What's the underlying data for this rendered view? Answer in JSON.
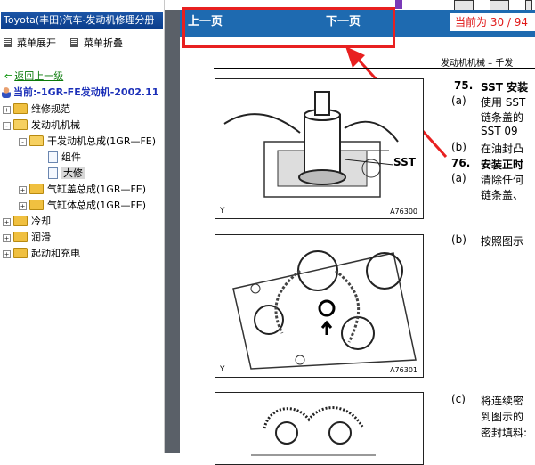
{
  "left_pane": {
    "title": "Toyota(丰田)汽车-发动机修理分册",
    "expand_label": "菜单展开",
    "collapse_label": "菜单折叠",
    "back_label": "返回上一级",
    "current_label": "当前:-1GR-FE发动机-2002.11",
    "tree": [
      {
        "label": "维修规范",
        "expander": "+",
        "type": "folder"
      },
      {
        "label": "发动机机械",
        "expander": "-",
        "type": "folder"
      },
      {
        "label": "干发动机总成(1GR—FE)",
        "expander": "-",
        "type": "folder"
      },
      {
        "label": "组件",
        "expander": "",
        "type": "doc"
      },
      {
        "label": "大修",
        "expander": "",
        "type": "doc",
        "selected": true
      },
      {
        "label": "气缸盖总成(1GR—FE)",
        "expander": "+",
        "type": "folder"
      },
      {
        "label": "气缸体总成(1GR—FE)",
        "expander": "+",
        "type": "folder"
      },
      {
        "label": "冷却",
        "expander": "+",
        "type": "folder"
      },
      {
        "label": "润滑",
        "expander": "+",
        "type": "folder"
      },
      {
        "label": "起动和充电",
        "expander": "+",
        "type": "folder"
      }
    ]
  },
  "toolbar": {
    "prev_label": "上一页",
    "next_label": "下一页",
    "page_indicator": "当前为 30 / 94"
  },
  "document": {
    "section_header": "发动机机械 – 千发",
    "figures": [
      {
        "code": "A76300",
        "corner": "Y",
        "callout": "SST"
      },
      {
        "code": "A76301",
        "corner": "Y"
      },
      {
        "code": "",
        "corner": ""
      }
    ],
    "steps": [
      {
        "text": "75.",
        "bold": true
      },
      {
        "text": "SST 安装",
        "bold": true
      },
      {
        "text": "(a)"
      },
      {
        "text": "使用 SST"
      },
      {
        "text": "链条盖的"
      },
      {
        "text": "SST   09"
      },
      {
        "text": "(b)"
      },
      {
        "text": "在油封凸"
      },
      {
        "text": "76.",
        "bold": true
      },
      {
        "text": "安装正时",
        "bold": true
      },
      {
        "text": "(a)"
      },
      {
        "text": "清除任何"
      },
      {
        "text": "链条盖、"
      },
      {
        "text": "(b)"
      },
      {
        "text": "按照图示"
      },
      {
        "text": "(c)"
      },
      {
        "text": "将连续密"
      },
      {
        "text": "到图示的"
      },
      {
        "text": "密封填料:"
      }
    ]
  },
  "colors": {
    "toolbar_bg": "#1e6ab0",
    "page_indicator_text": "#e01818",
    "annotation_red": "#e82020",
    "title_bar_bg": "#0a3c8a"
  }
}
